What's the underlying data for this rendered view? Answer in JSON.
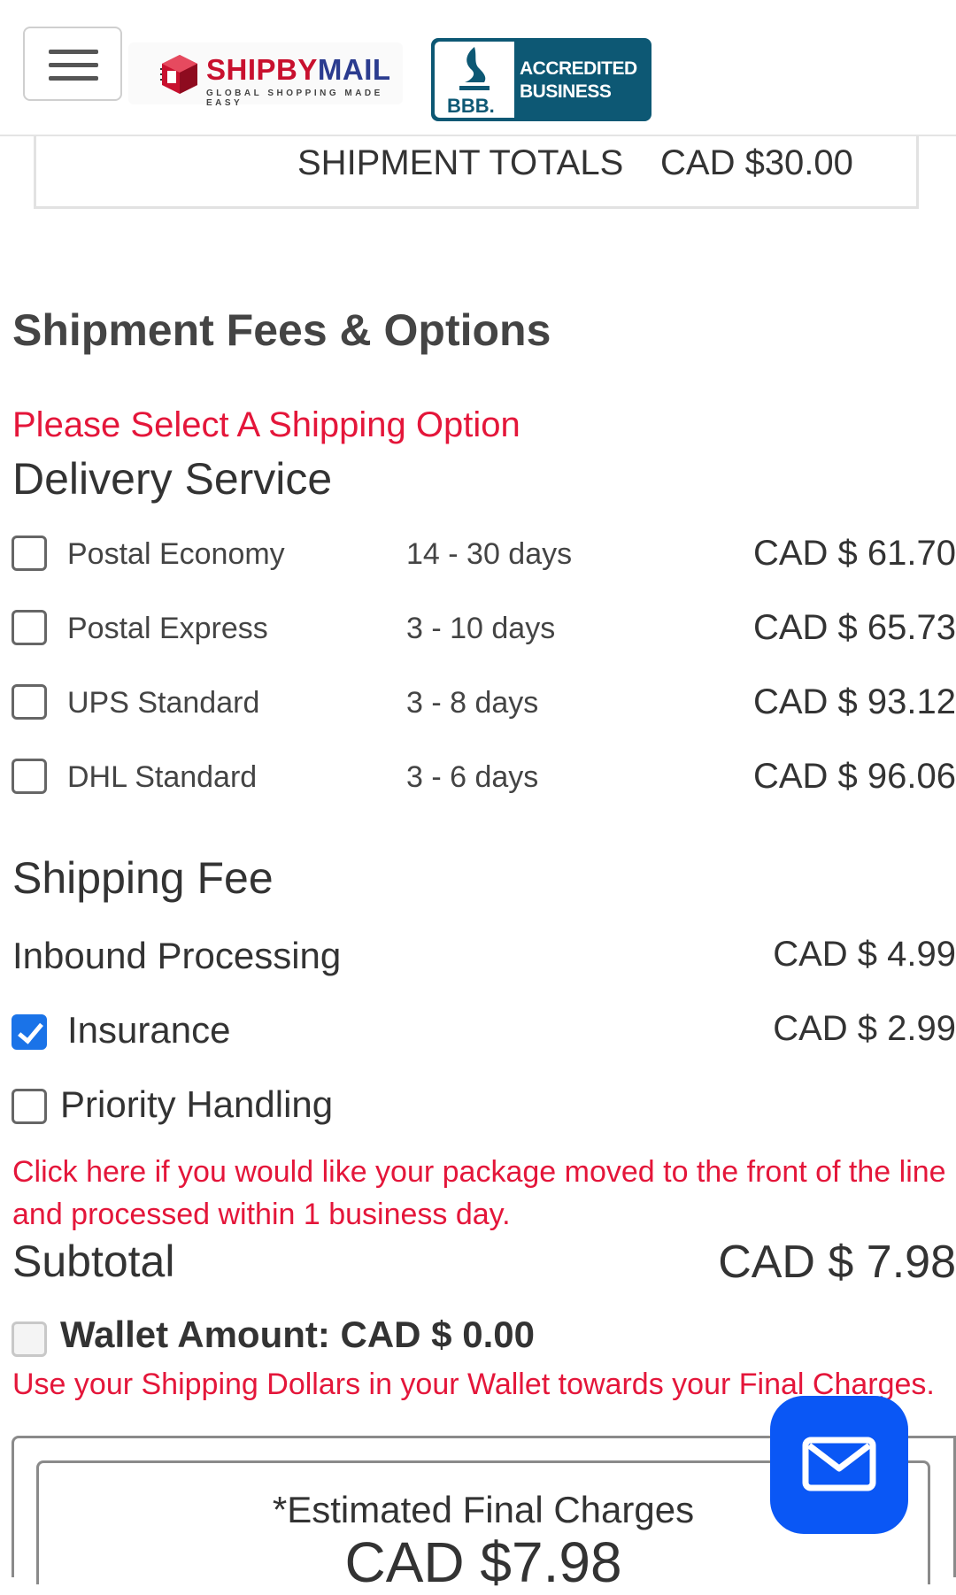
{
  "header": {
    "brand_part1": "SHIPBY",
    "brand_part2": "MAIL",
    "tagline": "GLOBAL SHOPPING MADE EASY",
    "bbb_line1": "ACCREDITED",
    "bbb_line2": "BUSINESS",
    "bbb_seal_text": "BBB."
  },
  "shipment_totals": {
    "label": "SHIPMENT TOTALS",
    "value": "CAD $30.00"
  },
  "fees": {
    "heading": "Shipment Fees & Options",
    "warning": "Please Select A Shipping Option",
    "delivery_heading": "Delivery Service",
    "options": [
      {
        "name": "Postal Economy",
        "days": "14 - 30 days",
        "price": "CAD $ 61.70",
        "checked": false
      },
      {
        "name": "Postal Express",
        "days": "3 - 10 days",
        "price": "CAD $ 65.73",
        "checked": false
      },
      {
        "name": "UPS Standard",
        "days": "3 - 8 days",
        "price": "CAD $ 93.12",
        "checked": false
      },
      {
        "name": "DHL Standard",
        "days": "3 - 6 days",
        "price": "CAD $ 96.06",
        "checked": false
      }
    ]
  },
  "shipping_fee": {
    "heading": "Shipping Fee",
    "inbound_label": "Inbound Processing",
    "inbound_price": "CAD $ 4.99",
    "insurance_label": "Insurance",
    "insurance_price": "CAD $ 2.99",
    "insurance_checked": true,
    "priority_label": "Priority Handling",
    "priority_checked": false,
    "priority_note": "Click here if you would like your package moved to the front of the line and processed within 1 business day."
  },
  "subtotal": {
    "label": "Subtotal",
    "value": "CAD $ 7.98"
  },
  "wallet": {
    "label": "Wallet Amount: CAD $ 0.00",
    "note": "Use your Shipping Dollars in your Wallet towards your Final Charges."
  },
  "estimate": {
    "label": "*Estimated Final Charges",
    "value": "CAD $7.98"
  },
  "colors": {
    "accent_red": "#e4163a",
    "chat_blue": "#0a57f5",
    "bbb_teal": "#0d5874",
    "check_blue": "#1a73e8"
  },
  "icons": {
    "menu": "hamburger-icon",
    "chat": "mail-icon"
  }
}
